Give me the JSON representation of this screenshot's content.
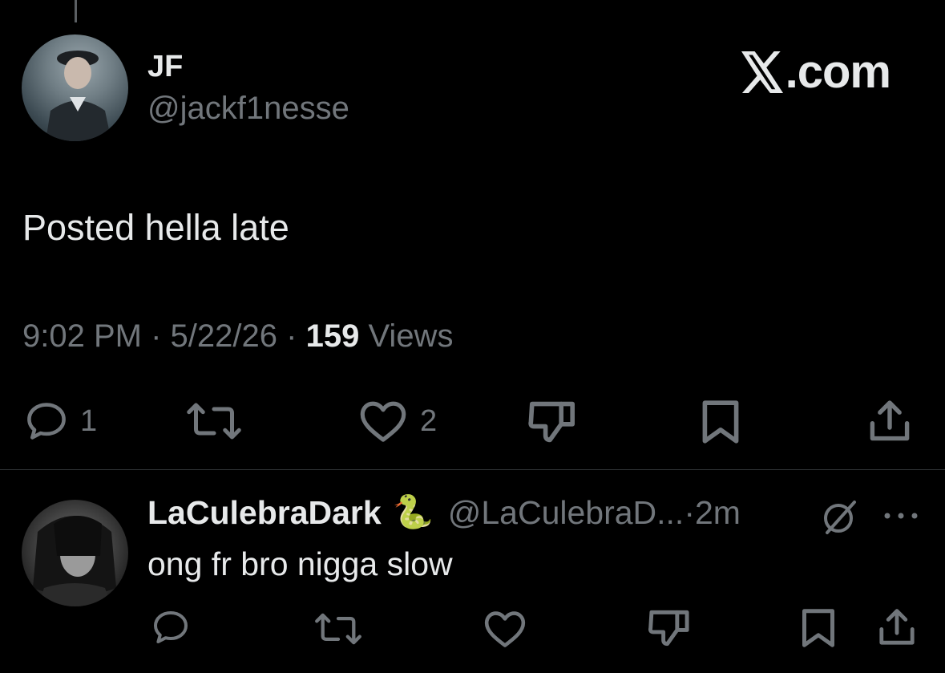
{
  "brand": {
    "label": ".com"
  },
  "post": {
    "display_name": "JF",
    "handle": "@jackf1nesse",
    "text": "Posted hella late",
    "time": "9:02 PM",
    "date": "5/22/26",
    "separator": "·",
    "views_count": "159",
    "views_label": "Views",
    "actions": {
      "reply_count": "1",
      "like_count": "2"
    }
  },
  "reply": {
    "display_name": "LaCulebraDark",
    "emoji": "🐍",
    "handle": "@LaCulebraD...",
    "separator": "·",
    "time": "2m",
    "text": "ong fr bro nigga slow"
  }
}
